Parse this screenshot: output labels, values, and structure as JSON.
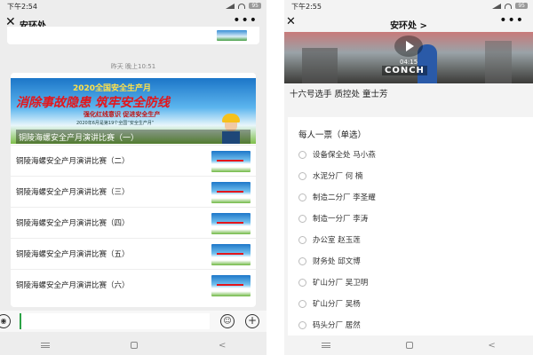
{
  "left": {
    "status": {
      "time": "下午2:54",
      "battery": "95"
    },
    "nav": {
      "title": "安环处"
    },
    "chat": {
      "timestamp": "昨天 晚上10:51",
      "banner": {
        "line1": "2020全国安全生产月",
        "line2": "消除事故隐患 筑牢安全防线",
        "line3": "强化红线意识 促进安全生产",
        "line4": "2020年6月是第19个全国“安全生产月”"
      },
      "card_title": "铜陵海螺安全产月演讲比赛（一）",
      "articles": [
        "铜陵海螺安全产月演讲比赛（二）",
        "铜陵海螺安全产月演讲比赛（三）",
        "铜陵海螺安全产月演讲比赛（四）",
        "铜陵海螺安全产月演讲比赛（五）",
        "铜陵海螺安全产月演讲比赛（六）"
      ]
    },
    "input": {
      "value": "",
      "voice_glyph": "◉",
      "emoji_glyph": "☺",
      "plus_glyph": "+"
    }
  },
  "right": {
    "status": {
      "time": "下午2:55",
      "battery": "95"
    },
    "nav": {
      "title": "安环处 >"
    },
    "video": {
      "duration": "04:15",
      "brand": "CONCH"
    },
    "caption": "十六号选手 质控处  童士芳",
    "poll": {
      "title": "每人一票（单选）",
      "options": [
        "设备保全处 马小燕",
        "水泥分厂 何 楠",
        "制造二分厂 李圣耀",
        "制造一分厂 李涛",
        "办公室 赵玉莲",
        "财务处 邱文博",
        "矿山分厂 吴卫明",
        "矿山分厂 吴杨",
        "码头分厂 居然"
      ]
    }
  },
  "glyphs": {
    "back": "✕",
    "more": "•••",
    "back_nav": "<"
  }
}
